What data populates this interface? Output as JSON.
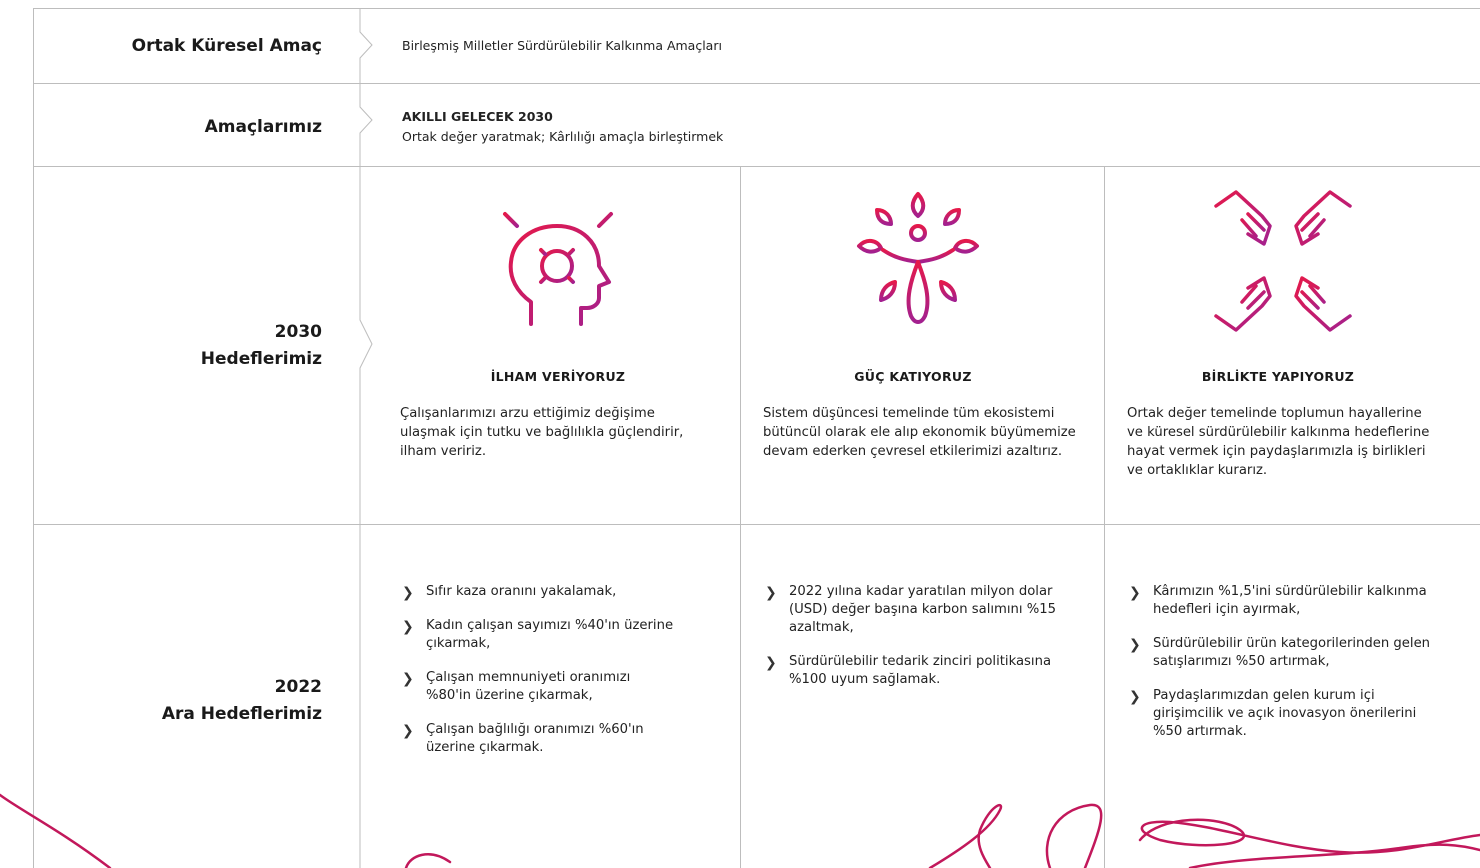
{
  "rows": {
    "goal_label": "Ortak Küresel Amaç",
    "goal_value": "Birleşmiş Milletler Sürdürülebilir Kalkınma Amaçları",
    "aims_label": "Amaçlarımız",
    "aims_title": "AKILLI GELECEK 2030",
    "aims_value": "Ortak değer yaratmak; Kârlılığı amaçla birleştirmek",
    "targets2030_line1": "2030",
    "targets2030_line2": "Hedeflerimiz",
    "targets2022_line1": "2022",
    "targets2022_line2": "Ara Hedeflerimiz"
  },
  "columns": [
    {
      "icon": "head-gear-icon",
      "title": "İLHAM VERİYORUZ",
      "desc_lines": [
        "Çalışanlarımızı arzu ettiğimiz değişime",
        "ulaşmak için tutku ve bağlılıkla güçlendirir,",
        "ilham veririz."
      ],
      "bullets": [
        [
          "Sıfır kaza oranını yakalamak,"
        ],
        [
          "Kadın çalışan sayımızı %40'ın üzerine",
          "çıkarmak,"
        ],
        [
          "Çalışan memnuniyeti oranımızı",
          "%80'in üzerine çıkarmak,"
        ],
        [
          "Çalışan bağlılığı oranımızı %60'ın",
          "üzerine çıkarmak."
        ]
      ]
    },
    {
      "icon": "tree-leaves-icon",
      "title": "GÜÇ KATIYORUZ",
      "desc_lines": [
        "Sistem düşüncesi temelinde tüm ekosistemi",
        "bütüncül olarak ele alıp ekonomik büyümemize",
        "devam ederken çevresel etkilerimizi azaltırız."
      ],
      "bullets": [
        [
          "2022 yılına kadar yaratılan milyon dolar",
          "(USD) değer başına karbon salımını %15",
          "azaltmak,"
        ],
        [
          "Sürdürülebilir tedarik zinciri politikasına",
          "%100 uyum sağlamak."
        ]
      ]
    },
    {
      "icon": "joined-hands-icon",
      "title": "BİRLİKTE YAPIYORUZ",
      "desc_lines": [
        "Ortak değer temelinde toplumun hayallerine",
        "ve küresel sürdürülebilir kalkınma hedeflerine",
        "hayat vermek için paydaşlarımızla iş birlikleri",
        "ve ortaklıklar kurarız."
      ],
      "bullets": [
        [
          "Kârımızın %1,5'ini sürdürülebilir kalkınma",
          "hedefleri için ayırmak,"
        ],
        [
          "Sürdürülebilir ürün kategorilerinden gelen",
          "satışlarımızı %50 artırmak,"
        ],
        [
          "Paydaşlarımızdan gelen kurum içi",
          "girişimcilik ve açık inovasyon önerilerini",
          "%50 artırmak."
        ]
      ]
    }
  ],
  "colors": {
    "accent_start": "#e5194a",
    "accent_end": "#a3208f",
    "ribbon": "#c2185b",
    "grid": "#bdbdbd"
  }
}
